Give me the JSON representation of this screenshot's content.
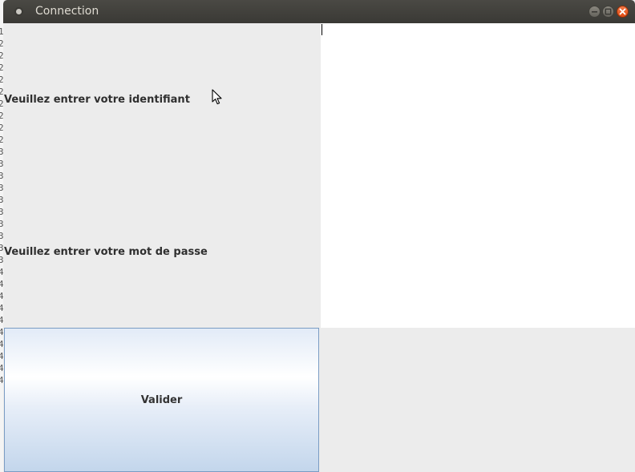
{
  "window": {
    "title": "Connection"
  },
  "form": {
    "username_label": "Veuillez entrer votre identifiant",
    "username_value": "",
    "password_label": "Veuillez entrer votre mot de passe",
    "password_value": "",
    "submit_label": "Valider"
  },
  "background_window": {
    "visible_chars": [
      "1",
      "2",
      "2",
      "2",
      "2",
      "2",
      "2",
      "2",
      "2",
      "2",
      "3",
      "3",
      "3",
      "3",
      "3",
      "3",
      "3",
      "3",
      "3",
      "3",
      "4",
      "4",
      "4",
      "4",
      "4",
      "4",
      "4",
      "4",
      "4",
      "4"
    ]
  },
  "colors": {
    "titlebar": "#3c3b37",
    "title_text": "#dfdbd2",
    "close_button": "#e9541c",
    "panel_background": "#ececec",
    "input_background": "#ffffff",
    "button_gradient_top": "#ffffff",
    "button_gradient_bottom": "#c3d6ec"
  },
  "icons": {
    "app_menu": "window-menu-dot-icon",
    "minimize": "minimize-icon",
    "maximize": "maximize-icon",
    "close": "close-icon",
    "mouse_pointer": "arrow-cursor-icon"
  }
}
